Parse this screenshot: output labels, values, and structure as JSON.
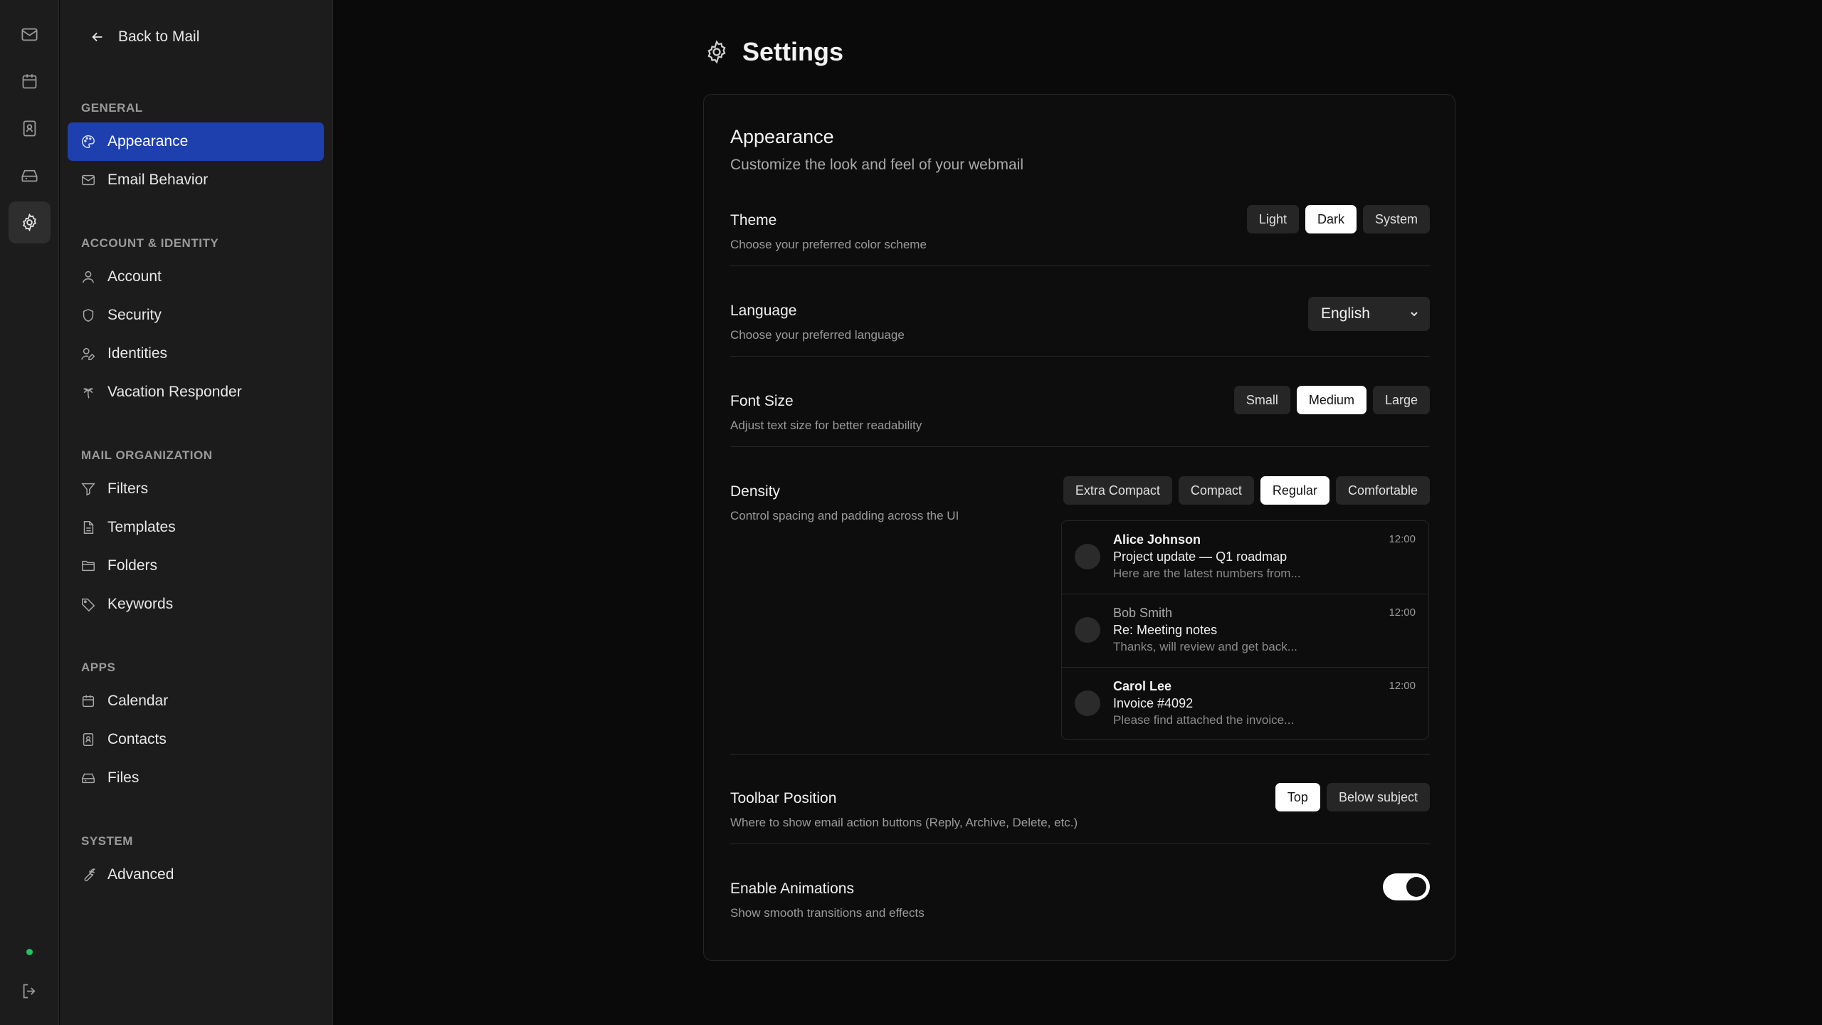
{
  "sidebar": {
    "back_label": "Back to Mail",
    "sections": {
      "general": "GENERAL",
      "account": "ACCOUNT & IDENTITY",
      "mail": "MAIL ORGANIZATION",
      "apps": "APPS",
      "system": "SYSTEM"
    },
    "items": {
      "appearance": "Appearance",
      "email_behavior": "Email Behavior",
      "account": "Account",
      "security": "Security",
      "identities": "Identities",
      "vacation": "Vacation Responder",
      "filters": "Filters",
      "templates": "Templates",
      "folders": "Folders",
      "keywords": "Keywords",
      "calendar": "Calendar",
      "contacts": "Contacts",
      "files": "Files",
      "advanced": "Advanced"
    },
    "active_item": "Appearance"
  },
  "rail": {
    "icons": [
      "mail-icon",
      "calendar-icon",
      "contacts-icon",
      "files-icon",
      "settings-icon"
    ],
    "active": "settings-icon",
    "status_color": "#22c55e"
  },
  "page": {
    "title": "Settings"
  },
  "appearance": {
    "title": "Appearance",
    "subtitle": "Customize the look and feel of your webmail",
    "theme": {
      "label": "Theme",
      "desc": "Choose your preferred color scheme",
      "options": [
        "Light",
        "Dark",
        "System"
      ],
      "selected": "Dark"
    },
    "language": {
      "label": "Language",
      "desc": "Choose your preferred language",
      "value": "English"
    },
    "font_size": {
      "label": "Font Size",
      "desc": "Adjust text size for better readability",
      "options": [
        "Small",
        "Medium",
        "Large"
      ],
      "selected": "Medium"
    },
    "density": {
      "label": "Density",
      "desc": "Control spacing and padding across the UI",
      "options": [
        "Extra Compact",
        "Compact",
        "Regular",
        "Comfortable"
      ],
      "selected": "Regular",
      "preview": [
        {
          "sender": "Alice Johnson",
          "subject": "Project update — Q1 roadmap",
          "preview": "Here are the latest numbers from...",
          "time": "12:00",
          "unread": true
        },
        {
          "sender": "Bob Smith",
          "subject": "Re: Meeting notes",
          "preview": "Thanks, will review and get back...",
          "time": "12:00",
          "unread": false
        },
        {
          "sender": "Carol Lee",
          "subject": "Invoice #4092",
          "preview": "Please find attached the invoice...",
          "time": "12:00",
          "unread": true
        }
      ]
    },
    "toolbar": {
      "label": "Toolbar Position",
      "desc": "Where to show email action buttons (Reply, Archive, Delete, etc.)",
      "options": [
        "Top",
        "Below subject"
      ],
      "selected": "Top"
    },
    "animations": {
      "label": "Enable Animations",
      "desc": "Show smooth transitions and effects",
      "enabled": true
    }
  },
  "colors": {
    "accent": "#1e40af",
    "background": "#0a0a0a",
    "panel": "#1c1c1c"
  }
}
